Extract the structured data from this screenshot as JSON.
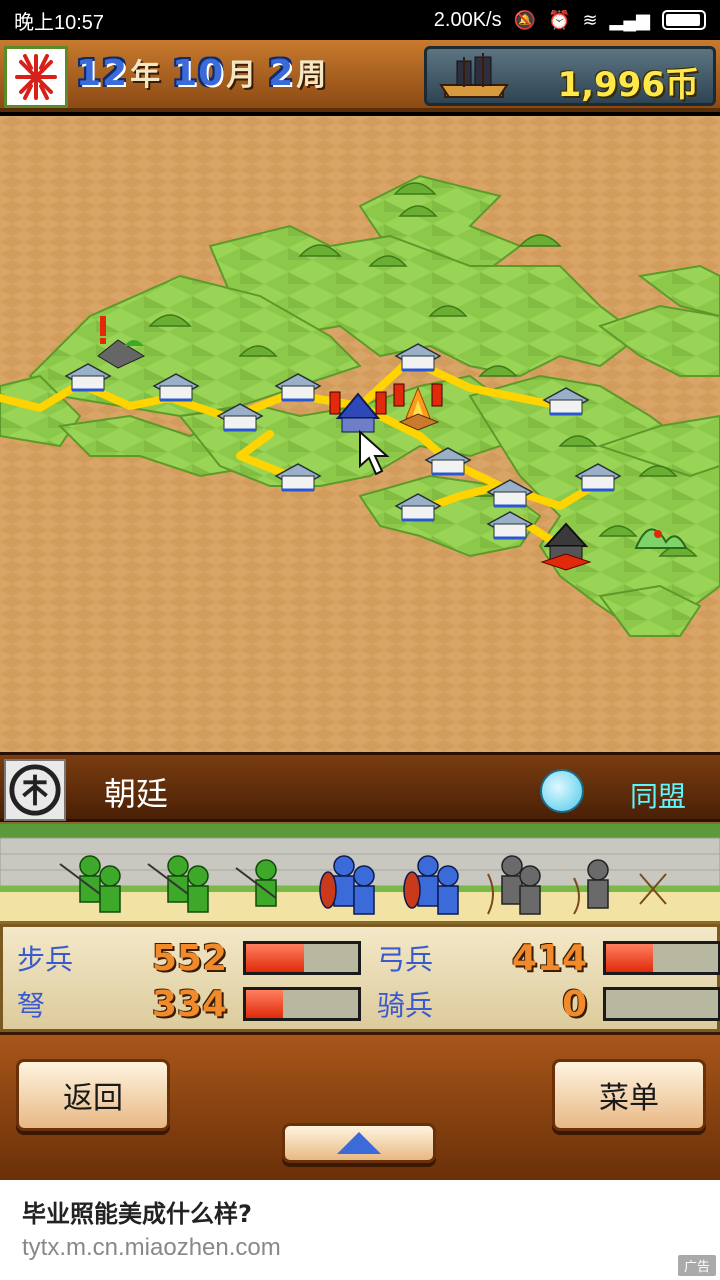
{
  "status_bar": {
    "time": "晚上10:57",
    "network_speed": "2.00K/s",
    "icons": [
      "mute-icon",
      "alarm-icon",
      "wifi-icon",
      "signal-icon",
      "battery-icon"
    ]
  },
  "header": {
    "year": "12",
    "year_unit": "年",
    "month": "10",
    "month_unit": "月",
    "week": "2",
    "week_unit": "周",
    "money": "1,996币"
  },
  "faction": {
    "name": "朝廷",
    "status": "同盟"
  },
  "stats": [
    {
      "label": "步兵",
      "value": "552",
      "fill": 0.52
    },
    {
      "label": "弓兵",
      "value": "414",
      "fill": 0.42
    },
    {
      "label": "弩",
      "value": "334",
      "fill": 0.33
    },
    {
      "label": "骑兵",
      "value": "0",
      "fill": 0
    }
  ],
  "buttons": {
    "back": "返回",
    "menu": "菜单",
    "up": "up-arrow-icon"
  },
  "ad": {
    "title": "毕业照能美成什么样?",
    "url": "tytx.m.cn.miaozhen.com",
    "badge": "广告"
  },
  "colors": {
    "grass": "#8cc84a",
    "sand": "#d8a466",
    "road": "#ffd400",
    "player_blue": "#3a6bd8",
    "enemy_red": "#e02a0a"
  }
}
